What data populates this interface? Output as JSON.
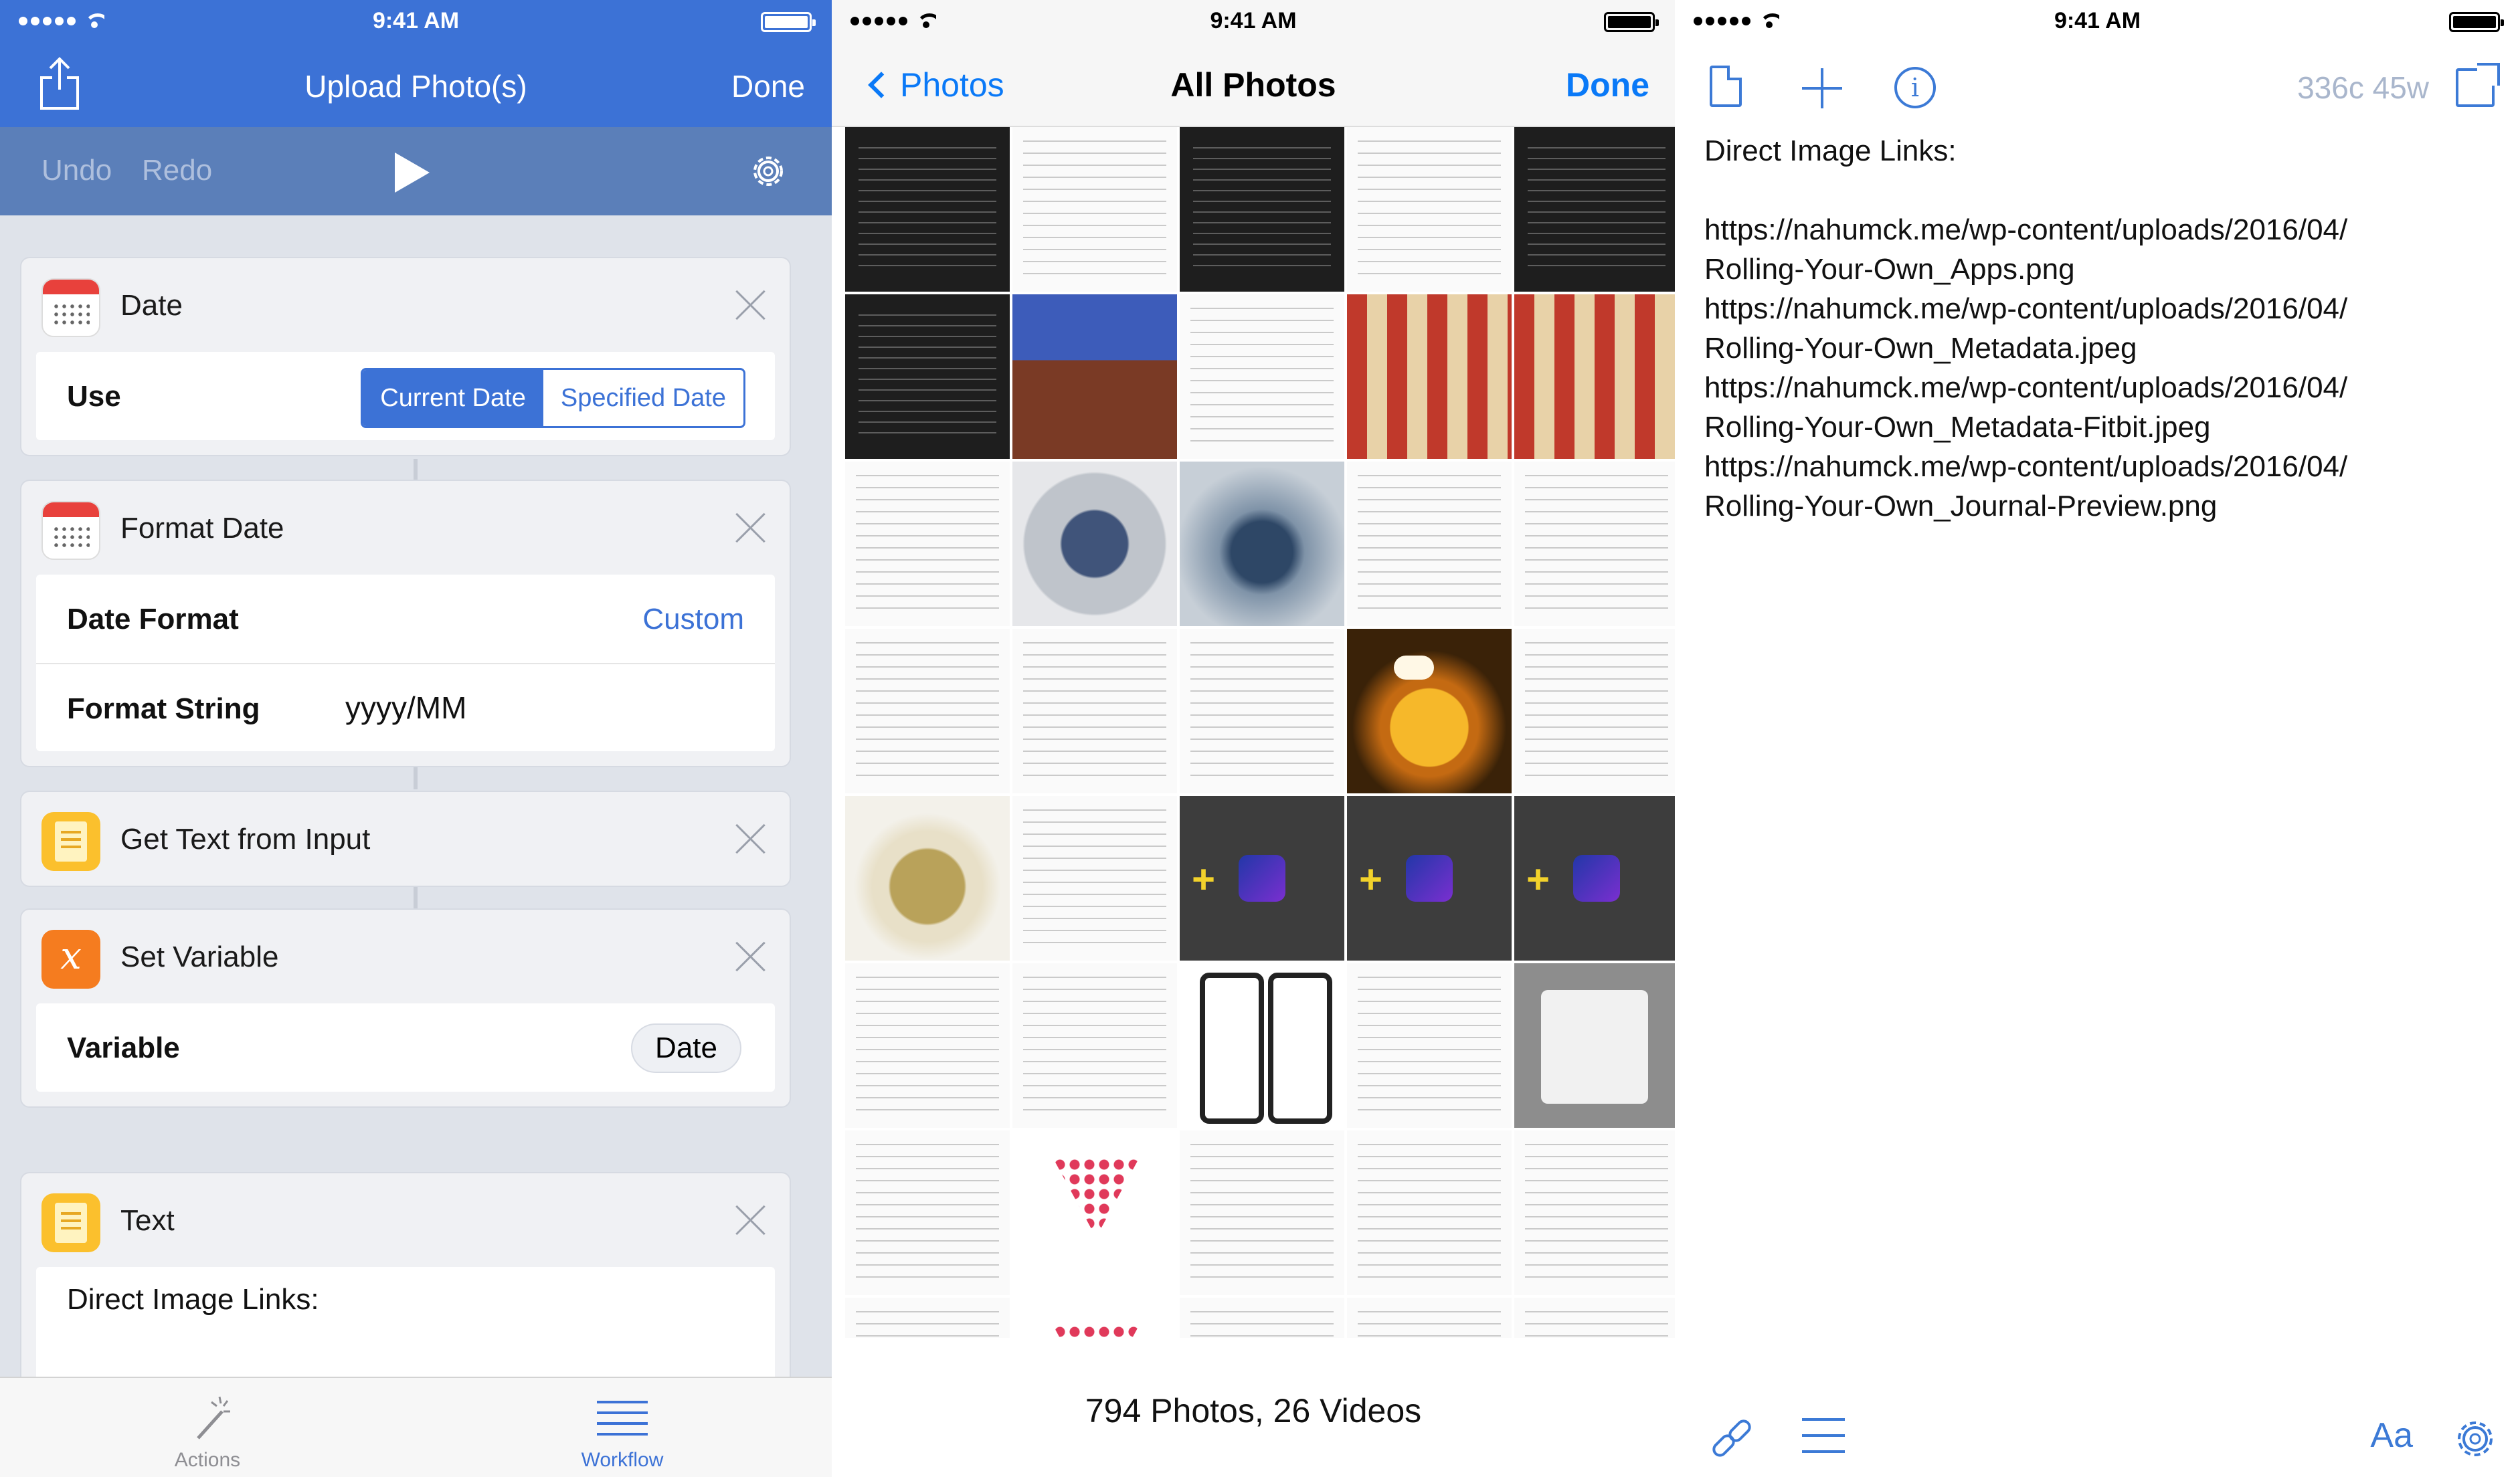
{
  "status": {
    "time": "9:41 AM"
  },
  "workflow": {
    "title": "Upload Photo(s)",
    "done": "Done",
    "undo": "Undo",
    "redo": "Redo",
    "actions": [
      {
        "name": "Date",
        "icon": "calendar-icon",
        "use_label": "Use",
        "segments": [
          "Current Date",
          "Specified Date"
        ],
        "selected": "Current Date"
      },
      {
        "name": "Format Date",
        "icon": "calendar-icon",
        "date_format_label": "Date Format",
        "date_format_value": "Custom",
        "format_string_label": "Format String",
        "format_string_value": "yyyy/MM"
      },
      {
        "name": "Get Text from Input",
        "icon": "note-icon"
      },
      {
        "name": "Set Variable",
        "icon": "variable-icon",
        "variable_label": "Variable",
        "variable_value": "Date"
      },
      {
        "name": "Text",
        "icon": "note-icon",
        "text": "Direct Image Links:"
      }
    ],
    "tabs": [
      {
        "label": "Actions",
        "icon": "magic-wand-icon",
        "active": false
      },
      {
        "label": "Workflow",
        "icon": "list-icon",
        "active": true
      }
    ],
    "colors": {
      "accent": "#3c72d6",
      "toolbar": "#5b7fb9"
    }
  },
  "photos": {
    "back": "Photos",
    "title": "All Photos",
    "done": "Done",
    "count": "794 Photos, 26 Videos",
    "accent": "#0a79f7"
  },
  "editor": {
    "word_count": "336c 45w",
    "heading": "Direct Image Links:",
    "links": [
      "https://nahumck.me/wp-content/uploads/2016/04/\nRolling-Your-Own_Apps.png",
      "https://nahumck.me/wp-content/uploads/2016/04/\nRolling-Your-Own_Metadata.jpeg",
      "https://nahumck.me/wp-content/uploads/2016/04/\nRolling-Your-Own_Metadata-Fitbit.jpeg",
      "https://nahumck.me/wp-content/uploads/2016/04/\nRolling-Your-Own_Journal-Preview.png"
    ],
    "font_button": "Aa",
    "accent": "#3c7ad6"
  }
}
